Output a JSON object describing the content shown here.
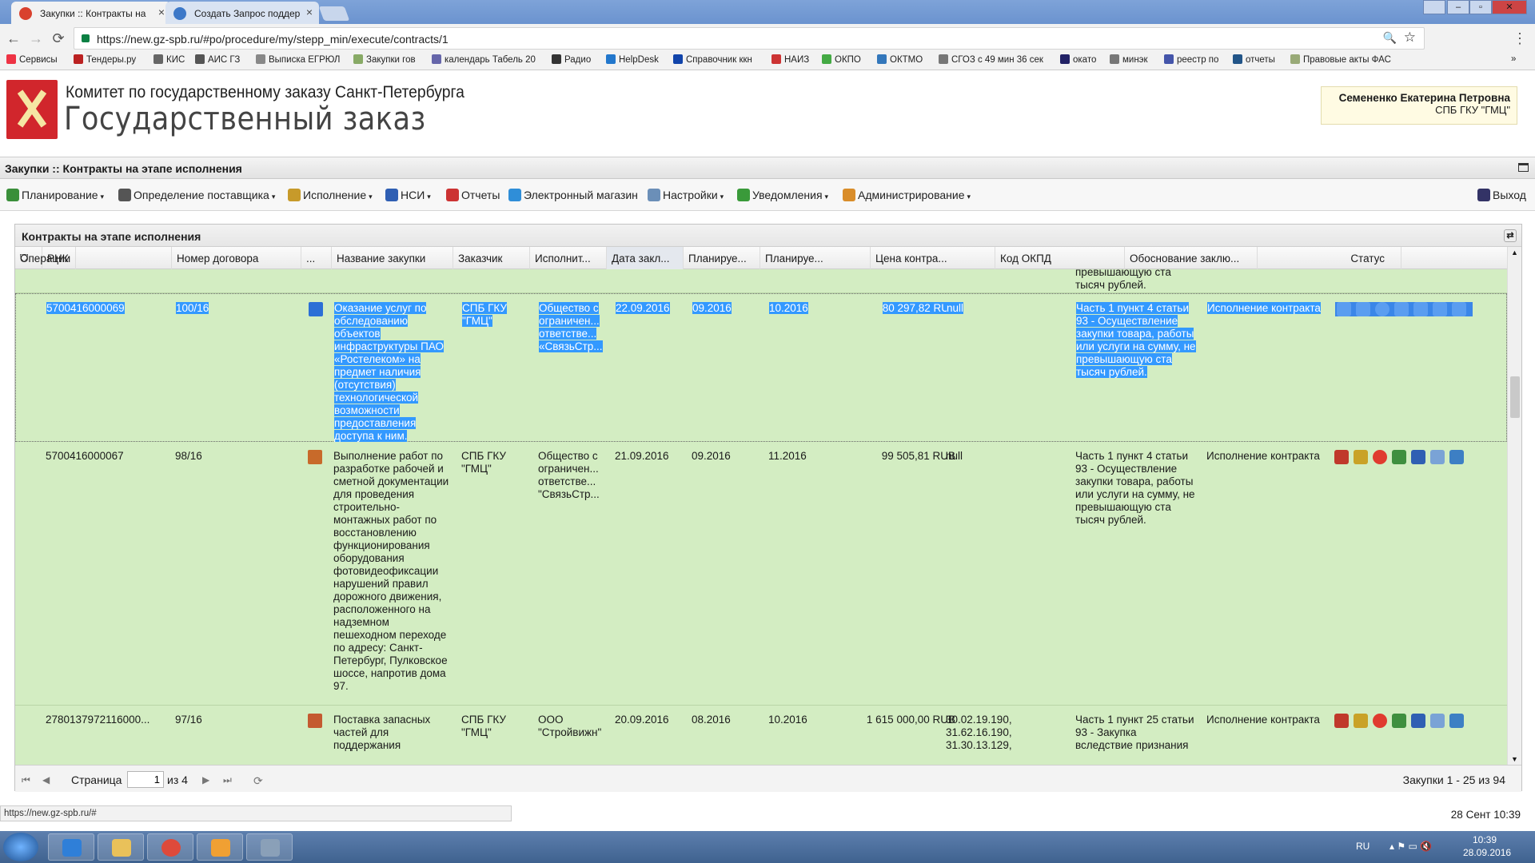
{
  "browser": {
    "tabs": [
      {
        "title": "Закупки :: Контракты на",
        "icon_color": "#d9412e"
      },
      {
        "title": "Создать Запрос поддер",
        "icon_color": "#3c78c8"
      }
    ],
    "url": "https://new.gz-spb.ru/#po/procedure/my/stepp_min/execute/contracts/1",
    "close_glyph": "×",
    "back_glyph": "←",
    "forward_glyph": "→",
    "reload_glyph": "⟳",
    "menu_glyph": "⋮",
    "star_glyph": "☆",
    "zoom_glyph": "🔍",
    "bookmarks": [
      "Сервисы",
      "Тендеры.ру",
      "КИС",
      "АИС ГЗ",
      "Выписка ЕГРЮЛ",
      "Закупки гов",
      "календарь Табель 20",
      "Радио",
      "HelpDesk",
      "Справочник ккн",
      "НАИЗ",
      "ОКПО",
      "ОКТМО",
      "СГОЗ с 49 мин 36 сек",
      "окато",
      "минэк",
      "реестр по",
      "отчеты",
      "Правовые акты ФАС"
    ],
    "bookmarks_more": "»"
  },
  "header": {
    "org": "Комитет по государственному заказу Санкт-Петербурга",
    "site": "Государственный заказ",
    "user_name": "Семененко Екатерина Петровна",
    "user_org": "СПБ ГКУ \"ГМЦ\"",
    "brand_color": "#d1262c"
  },
  "page_title": "Закупки :: Контракты на этапе исполнения",
  "menu": [
    "Планирование",
    "Определение поставщика",
    "Исполнение",
    "НСИ",
    "Отчеты",
    "Электронный магазин",
    "Настройки",
    "Уведомления",
    "Администрирование",
    "Выход"
  ],
  "menu_has_caret": [
    true,
    true,
    true,
    true,
    false,
    false,
    true,
    true,
    true,
    false
  ],
  "caret": "▾",
  "panel_title": "Контракты на этапе исполнения",
  "columns": [
    "РНК",
    "Номер договора",
    "...",
    "Название закупки",
    "Заказчик",
    "Исполнит...",
    "Дата закл...",
    "Планируе...",
    "Планируе...",
    "Цена контра...",
    "Код ОКПД",
    "Обоснование заклю...",
    "Статус",
    "Операции"
  ],
  "partial_row": {
    "reason_tail": "превышающую ста тысяч рублей."
  },
  "rows": [
    {
      "rnk": "5700416000069",
      "num": "100/16",
      "name": "Оказание услуг по обследованию объектов инфраструктуры ПАО «Ростелеком» на предмет наличия (отсутствия) технологической возможности предоставления доступа к ним.",
      "customer": "СПБ ГКУ \"ГМЦ\"",
      "executor": "Общество с ограничен... ответстве... «СвязьСтр...",
      "date": "22.09.2016",
      "plan1": "09.2016",
      "plan2": "10.2016",
      "price": "80 297,82 RUB",
      "okpd": "null",
      "reason": "Часть 1 пункт 4 статьи 93 - Осуществление закупки товара, работы или услуги на сумму, не превышающую ста тысяч рублей.",
      "status": "Исполнение контракта",
      "selected": true
    },
    {
      "rnk": "5700416000067",
      "num": "98/16",
      "name": "Выполнение работ по разработке рабочей и сметной документации для проведения строительно-монтажных работ по восстановлению функционирования оборудования фотовидеофиксации нарушений правил дорожного движения, расположенного на надземном пешеходном переходе по адресу: Санкт-Петербург, Пулковское шоссе, напротив дома 97.",
      "customer": "СПБ ГКУ \"ГМЦ\"",
      "executor": "Общество с ограничен... ответстве... \"СвязьСтр...",
      "date": "21.09.2016",
      "plan1": "09.2016",
      "plan2": "11.2016",
      "price": "99 505,81 RUB",
      "okpd": "null",
      "reason": "Часть 1 пункт 4 статьи 93 - Осуществление закупки товара, работы или услуги на сумму, не превышающую ста тысяч рублей.",
      "status": "Исполнение контракта",
      "selected": false
    },
    {
      "rnk": "2780137972116000...",
      "num": "97/16",
      "name": "Поставка запасных частей для поддержания",
      "customer": "СПБ ГКУ \"ГМЦ\"",
      "executor": "ООО \"Стройвижн\"",
      "date": "20.09.2016",
      "plan1": "08.2016",
      "plan2": "10.2016",
      "price": "1 615 000,00 RUB",
      "okpd": "30.02.19.190, 31.62.16.190, 31.30.13.129,",
      "reason": "Часть 1 пункт 25 статьи 93 - Закупка вследствие признания",
      "status": "Исполнение контракта",
      "selected": false
    }
  ],
  "op_icon_colors": [
    "#c0392b",
    "#c9a227",
    "#e03b2f",
    "#3f8f3f",
    "#2f5fb3",
    "#7aa3d6",
    "#3d7fc4"
  ],
  "pager": {
    "label": "Страница",
    "page": "1",
    "of": "из 4",
    "summary": "Закупки 1 - 25 из 94"
  },
  "status_url": "https://new.gz-spb.ru/#",
  "status_date": "28 Сент 10:39",
  "taskbar": {
    "lang": "RU",
    "time": "10:39",
    "date": "28.09.2016"
  }
}
